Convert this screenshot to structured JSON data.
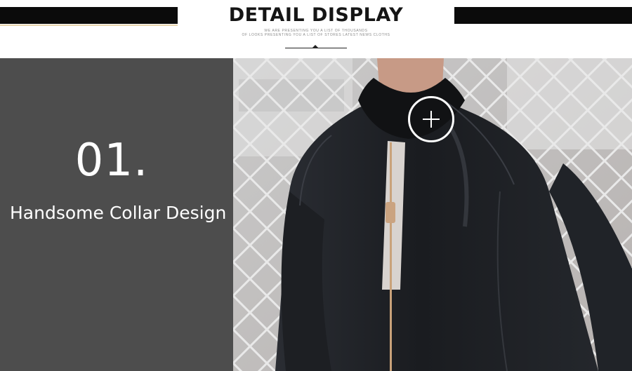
{
  "header": {
    "title": "DETAIL DISPLAY",
    "subtitle_line1": "WE ARE PRESENTING YOU A LIST OF THOUSANDS",
    "subtitle_line2": "OF LOOKS PRESENTING YOU A LIST OF STORES LATEST NEWS CLOTHS"
  },
  "feature": {
    "number": "01.",
    "caption": "Handsome Collar Design"
  },
  "photo": {
    "icon": "zoom-plus-icon"
  },
  "colors": {
    "panel": "#4d4d4d",
    "bars": "#0b0b0b",
    "jacket": "#1c1e22"
  }
}
